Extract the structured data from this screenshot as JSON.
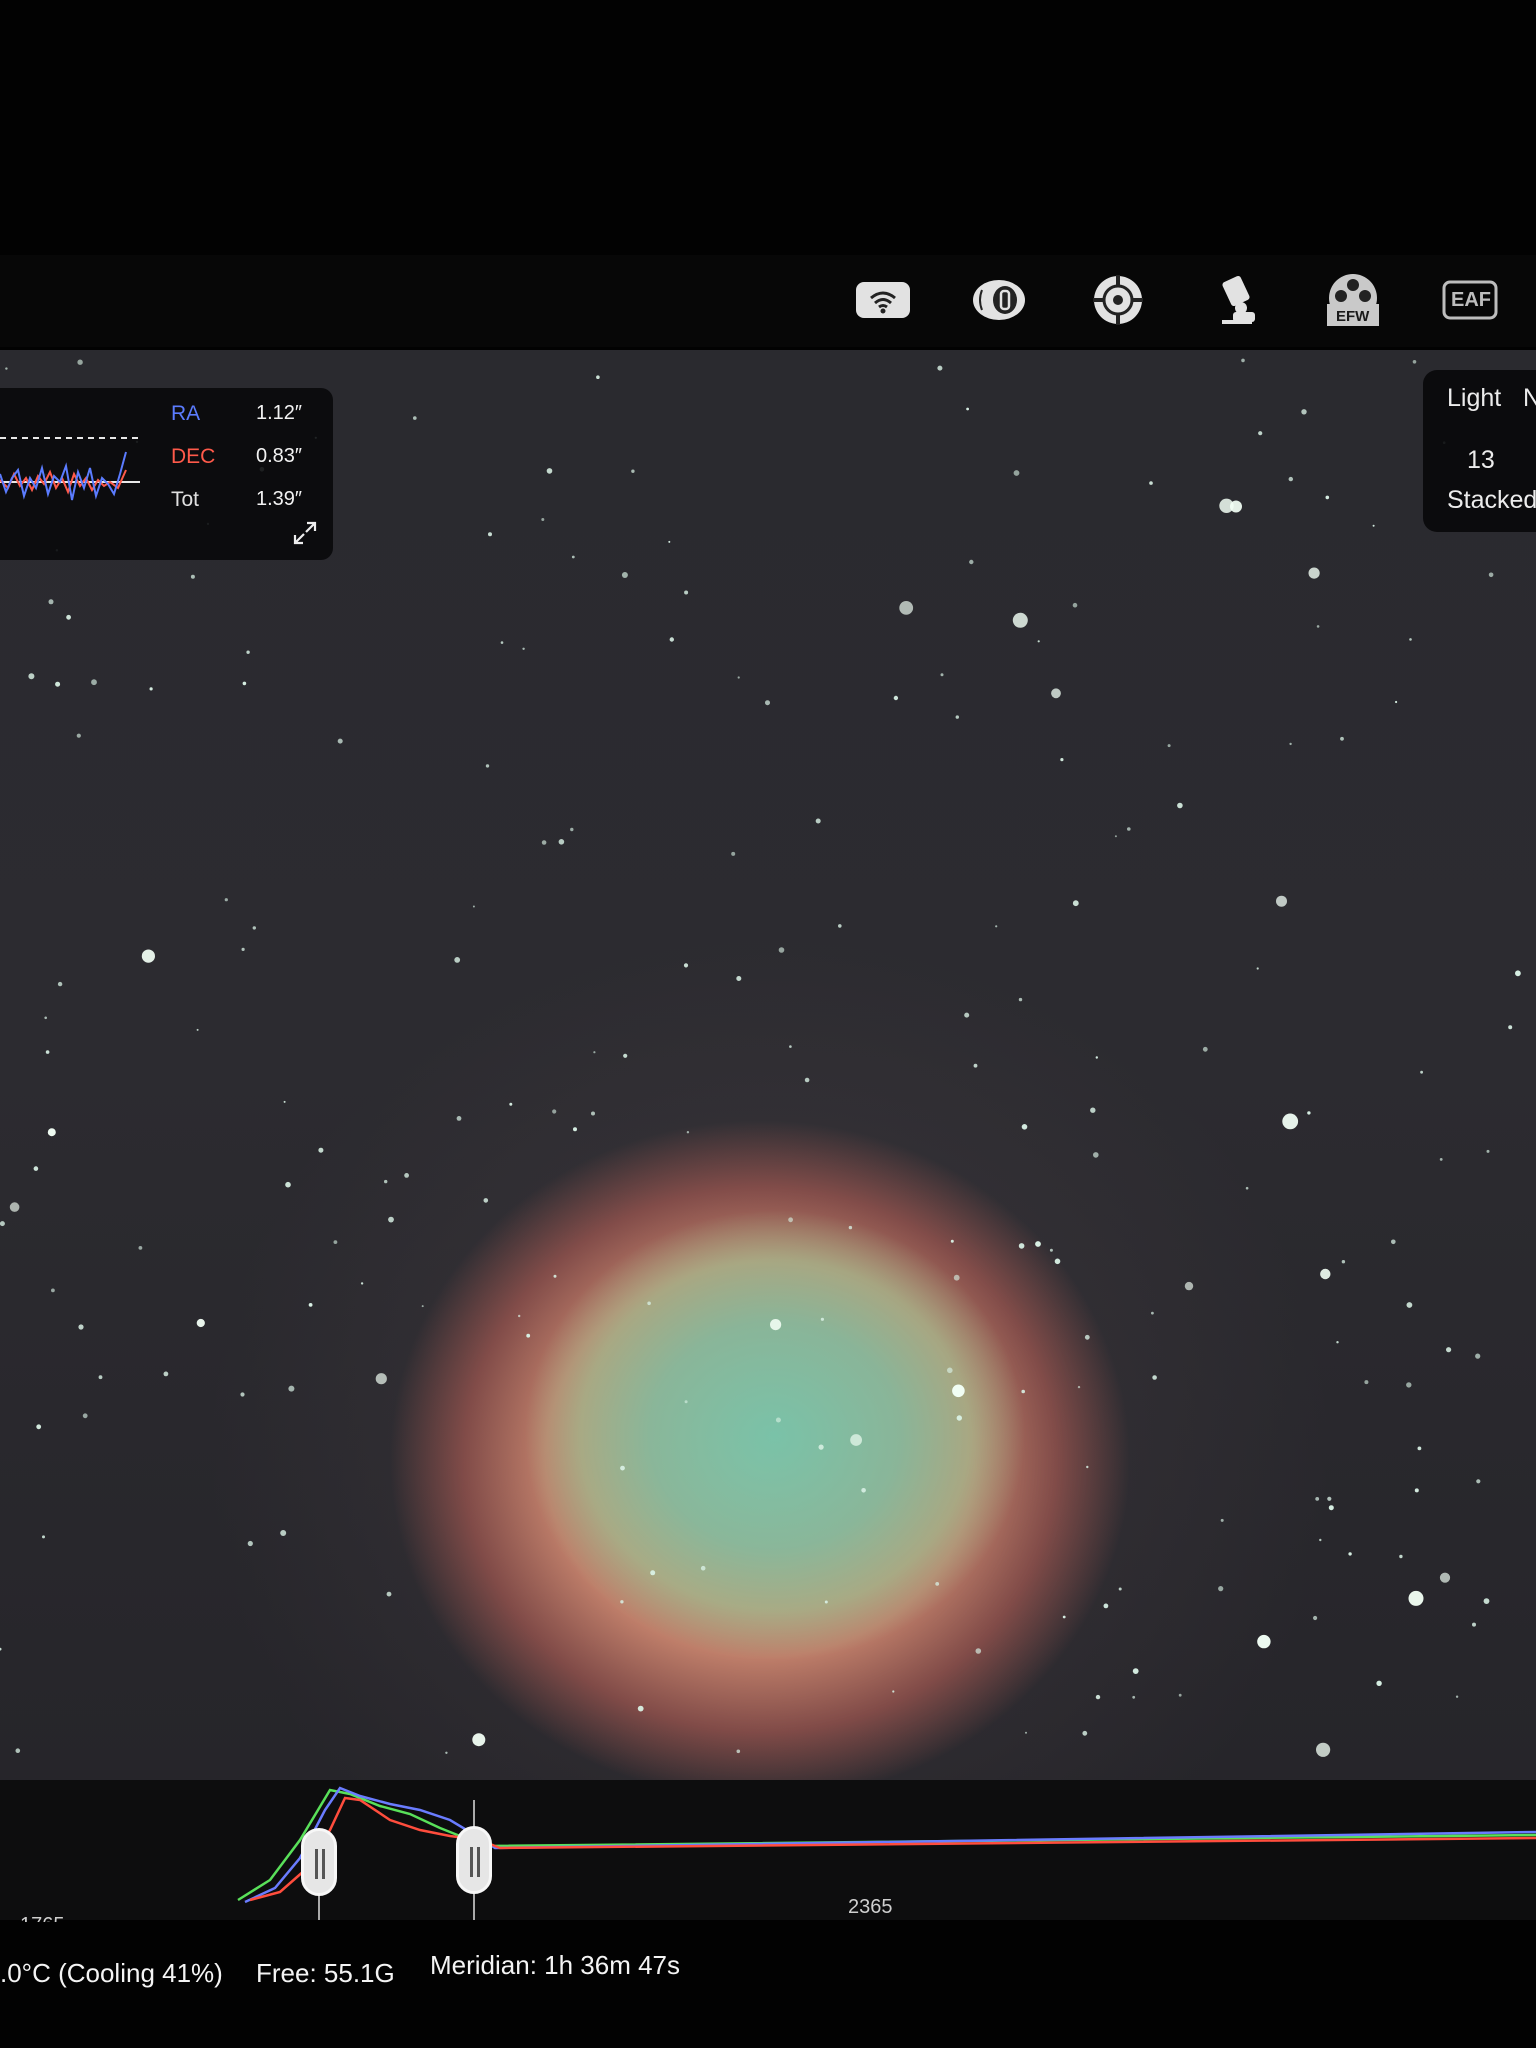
{
  "toolbar": {
    "icons": [
      "wifi-icon",
      "storage-icon",
      "focus-target-icon",
      "telescope-mount-icon",
      "filter-wheel-icon",
      "focuser-icon"
    ],
    "efw_label": "EFW",
    "eaf_label": "EAF"
  },
  "guiding": {
    "ra_label": "RA",
    "ra_value": "1.12″",
    "dec_label": "DEC",
    "dec_value": "0.83″",
    "tot_label": "Tot",
    "tot_value": "1.39″",
    "colors": {
      "ra": "#5b7cff",
      "dec": "#ff5a4a"
    }
  },
  "capture": {
    "frame_type": "Light",
    "extra_label": "N",
    "stacked_count": "13",
    "stacked_label": "Stacked"
  },
  "histogram": {
    "left_value": "1765",
    "right_value": "2365"
  },
  "status": {
    "cooling": ".0°C (Cooling 41%)",
    "free": "Free: 55.1G",
    "meridian": "Meridian: 1h 36m 47s"
  }
}
